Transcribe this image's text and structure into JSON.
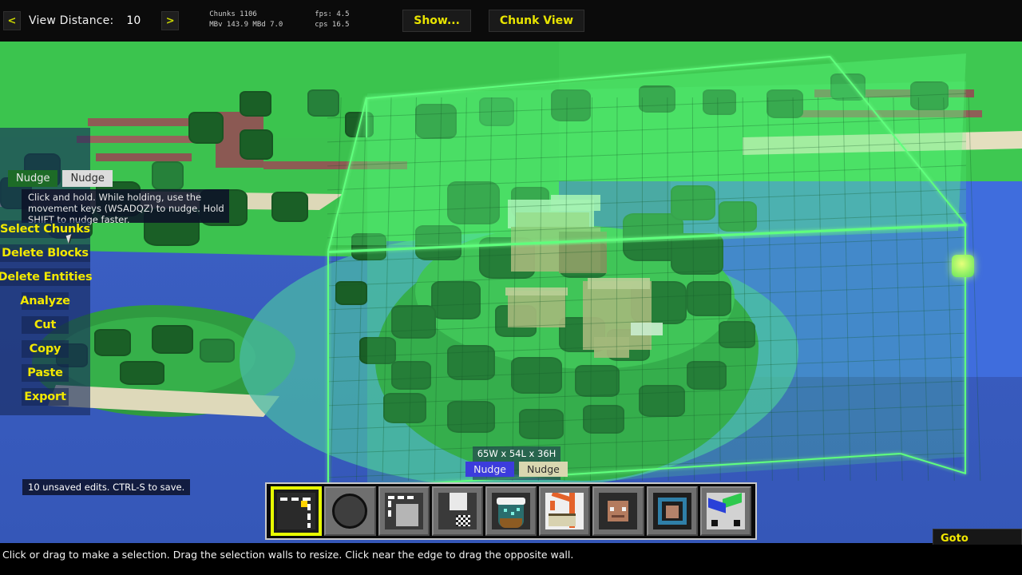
{
  "topbar": {
    "prev_label": "<",
    "next_label": ">",
    "view_distance_label": "View Distance:",
    "view_distance_value": "10",
    "stats": {
      "chunks": "Chunks 1106",
      "fps": "fps: 4.5",
      "memory": "MBv 143.9   MBd 7.0",
      "cps": "cps 16.5"
    },
    "show_button": "Show...",
    "chunk_view_button": "Chunk View"
  },
  "sidebar": {
    "nudge_left": "Nudge",
    "nudge_right": "Nudge",
    "tooltip": "Click and hold.  While holding, use the movement keys (WSADQZ) to nudge. Hold SHIFT to nudge faster.",
    "buttons": [
      {
        "label": "Select Chunks"
      },
      {
        "label": "Delete Blocks"
      },
      {
        "label": "Delete Entities"
      },
      {
        "label": "Analyze"
      },
      {
        "label": "Cut"
      },
      {
        "label": "Copy"
      },
      {
        "label": "Paste"
      },
      {
        "label": "Export"
      }
    ]
  },
  "selection": {
    "size_label": "65W x 54L x 36H",
    "nudge_primary": "Nudge",
    "nudge_secondary": "Nudge",
    "box_color": "#5fff7d",
    "handle_color": "#b4f56a"
  },
  "unsaved": {
    "message": "10 unsaved edits.  CTRL-S to save."
  },
  "toolbar": {
    "tools": [
      {
        "name": "selection-tool",
        "selected": true
      },
      {
        "name": "brush-tool",
        "selected": false
      },
      {
        "name": "clone-tool",
        "selected": false
      },
      {
        "name": "fill-tool",
        "selected": false
      },
      {
        "name": "filter-tool",
        "selected": false
      },
      {
        "name": "construction-tool",
        "selected": false
      },
      {
        "name": "player-tool",
        "selected": false
      },
      {
        "name": "spawn-tool",
        "selected": false
      },
      {
        "name": "chunk-tool",
        "selected": false
      }
    ]
  },
  "goto": {
    "label": "Goto Dimension"
  },
  "statusbar": {
    "message": "Click or drag to make a selection. Drag the selection walls to resize. Click near the edge to drag the opposite wall."
  },
  "colors": {
    "accent_yellow": "#f2e800",
    "grass": "#3ec851",
    "ocean": "#3f6ddd",
    "sand": "#e8e3c4",
    "cliff": "#8d5a55",
    "tree": "#1f6f2c"
  }
}
